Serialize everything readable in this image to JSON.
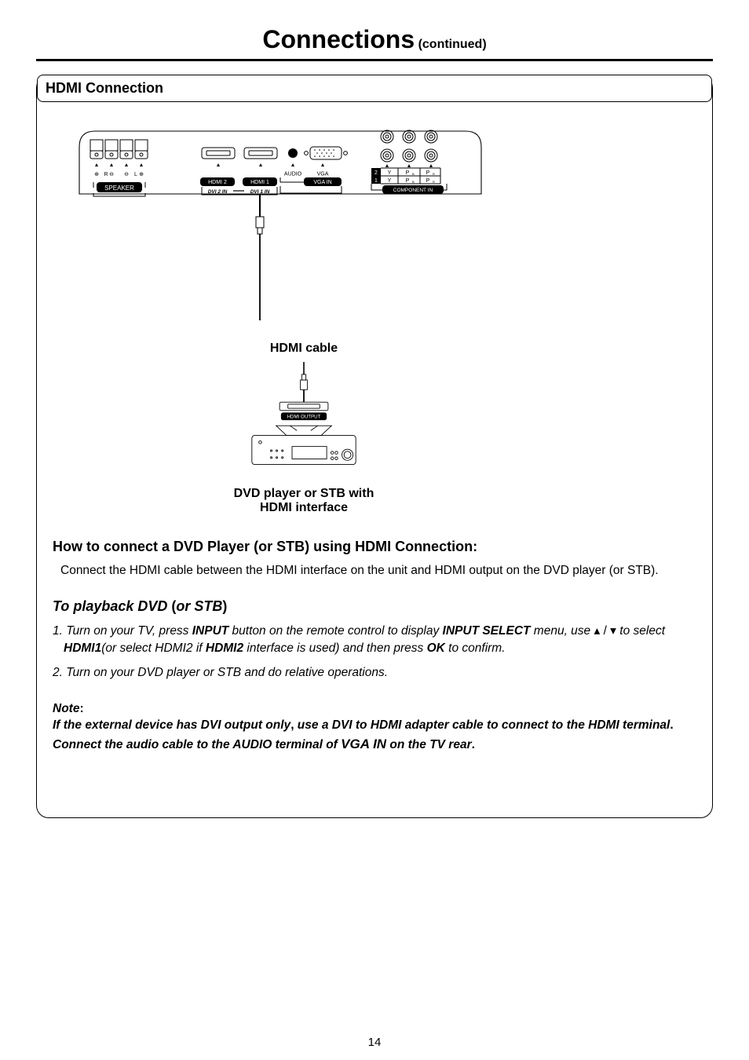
{
  "page": {
    "title_main": "Connections",
    "title_sub": "(continued)",
    "number": "14"
  },
  "section": {
    "header": "HDMI Connection"
  },
  "diagram": {
    "speaker_label": "SPEAKER",
    "port_hdmi2": "HDMI 2",
    "port_hdmi1": "HDMI 1",
    "port_audio": "AUDIO",
    "port_vga": "VGA",
    "port_vgain": "VGA IN",
    "dvi2in": "DVI 2 IN",
    "dvi1in": "DVI 1 IN",
    "row2": "2",
    "row1": "1",
    "y": "Y",
    "pb": "P",
    "pb_sub": "B",
    "pr": "P",
    "pr_sub": "R",
    "componentin": "COMPONENT IN",
    "cable_caption": "HDMI cable",
    "hdmi_output": "HDMI OUTPUT",
    "device_caption_l1": "DVD player or STB with",
    "device_caption_l2": "HDMI interface"
  },
  "howto": {
    "header_pre": "How to connect a DVD Player",
    "header_paren": "(or STB)",
    "header_post": " using HDMI Connection:",
    "paragraph": "Connect the HDMI cable between the HDMI interface on the unit and HDMI output on the DVD player (or STB)."
  },
  "playback": {
    "header_pre": "To playback DVD",
    "header_paren": "(or STB)",
    "item1_a": "1. Turn on your TV, press ",
    "item1_input": "INPUT",
    "item1_b": " button on the remote control to display ",
    "item1_inputselect": "INPUT SELECT",
    "item1_c": " menu, use ",
    "item1_arrows": "▴ / ▾",
    "item1_d": " to select ",
    "item1_hdmi1": "HDMI1",
    "item1_e": "(or select HDMI2 if ",
    "item1_hdmi2": "HDMI2",
    "item1_f": " interface is used) and then press ",
    "item1_ok": "OK",
    "item1_g": " to confirm.",
    "item2": "2. Turn on your DVD player or STB and do relative operations."
  },
  "note": {
    "label": "Note",
    "colon": ":",
    "line_a": "If the external device has DVI output only",
    "comma1": ",",
    "line_b": "  use a DVI to HDMI adapter cable to connect to the HDMI terminal",
    "period1": ".",
    "line_c": "  Connect the audio cable to the AUDIO terminal of ",
    "vga_in": "VGA IN",
    "line_d": " on the TV rear",
    "period2": "."
  }
}
